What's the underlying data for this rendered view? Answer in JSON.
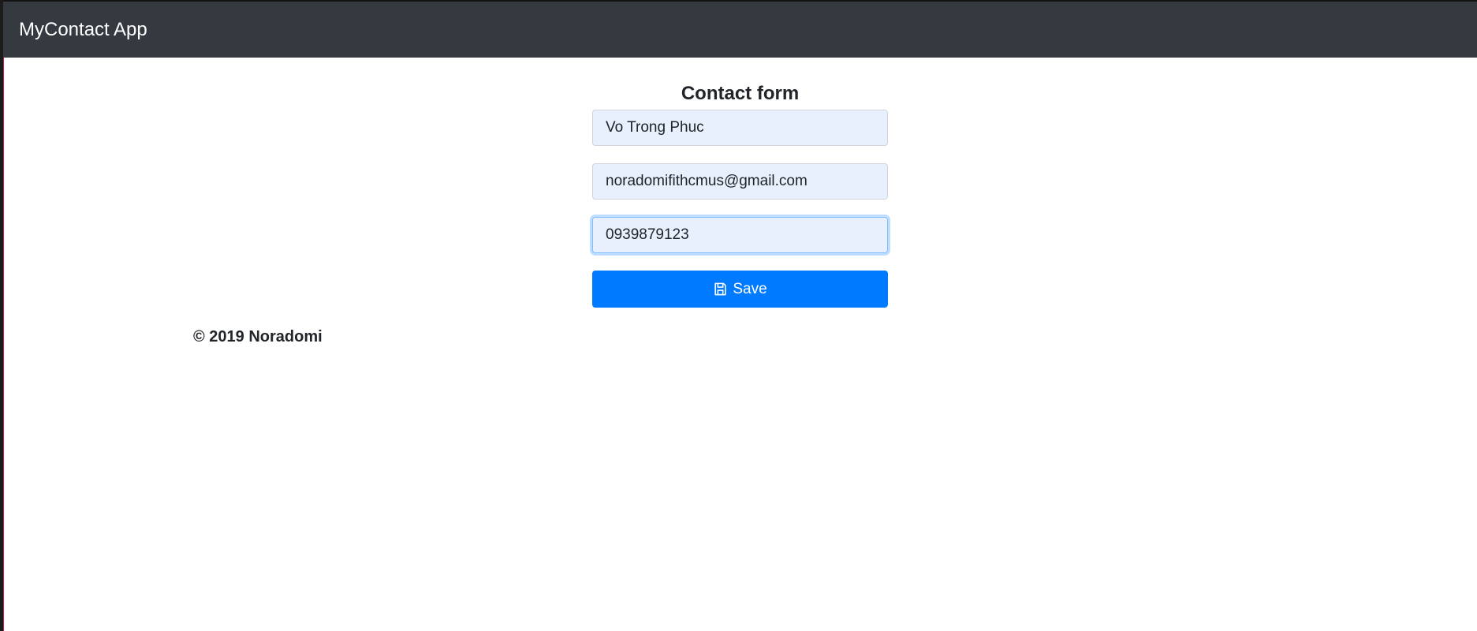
{
  "app": {
    "brand": "MyContact App"
  },
  "form": {
    "title": "Contact form",
    "fields": [
      {
        "name": "name",
        "value": "Vo Trong Phuc",
        "placeholder": ""
      },
      {
        "name": "email",
        "value": "noradomifithcmus@gmail.com",
        "placeholder": ""
      },
      {
        "name": "phone",
        "value": "0939879123",
        "placeholder": ""
      }
    ],
    "save_label": "Save"
  },
  "footer": {
    "text": "© 2019 Noradomi"
  },
  "colors": {
    "navbar": "#343a40",
    "input_background": "#e8f0fe",
    "primary": "#007bff",
    "text": "#212529"
  },
  "icons": {
    "save": "floppy-disk-icon"
  }
}
